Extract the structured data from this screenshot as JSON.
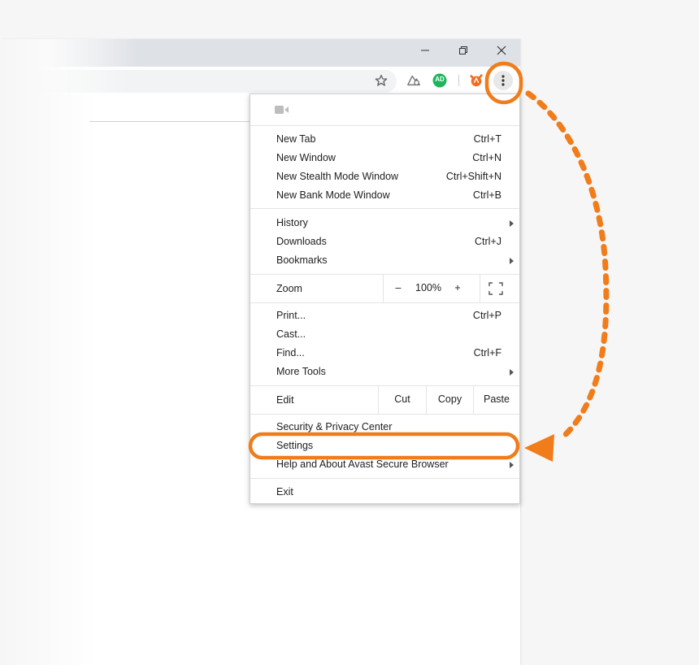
{
  "window_controls": {
    "minimize_icon": "minimize-icon",
    "restore_icon": "restore-icon",
    "close_icon": "close-icon"
  },
  "toolbar": {
    "bookmark_icon": "star-icon",
    "extension_icon": "privacy-extension-icon",
    "adblock_badge": "AD",
    "avast_icon": "avast-logo-icon",
    "menu_icon": "three-dots-menu-icon"
  },
  "menu": {
    "camera_icon": "video-camera-icon",
    "group1": [
      {
        "label": "New Tab",
        "shortcut": "Ctrl+T"
      },
      {
        "label": "New Window",
        "shortcut": "Ctrl+N"
      },
      {
        "label": "New Stealth Mode Window",
        "shortcut": "Ctrl+Shift+N"
      },
      {
        "label": "New Bank Mode Window",
        "shortcut": "Ctrl+B"
      }
    ],
    "group2": [
      {
        "label": "History",
        "shortcut": ""
      },
      {
        "label": "Downloads",
        "shortcut": "Ctrl+J"
      },
      {
        "label": "Bookmarks",
        "shortcut": ""
      }
    ],
    "zoom": {
      "label": "Zoom",
      "minus": "–",
      "value": "100%",
      "plus": "+"
    },
    "group3": [
      {
        "label": "Print...",
        "shortcut": "Ctrl+P"
      },
      {
        "label": "Cast...",
        "shortcut": ""
      },
      {
        "label": "Find...",
        "shortcut": "Ctrl+F"
      },
      {
        "label": "More Tools",
        "shortcut": ""
      }
    ],
    "edit": {
      "label": "Edit",
      "cut": "Cut",
      "copy": "Copy",
      "paste": "Paste"
    },
    "group4": [
      {
        "label": "Security & Privacy Center",
        "shortcut": ""
      },
      {
        "label": "Settings",
        "shortcut": ""
      },
      {
        "label": "Help and About Avast Secure Browser",
        "shortcut": ""
      }
    ],
    "exit": "Exit"
  },
  "annotation_color": "#f07c1a"
}
